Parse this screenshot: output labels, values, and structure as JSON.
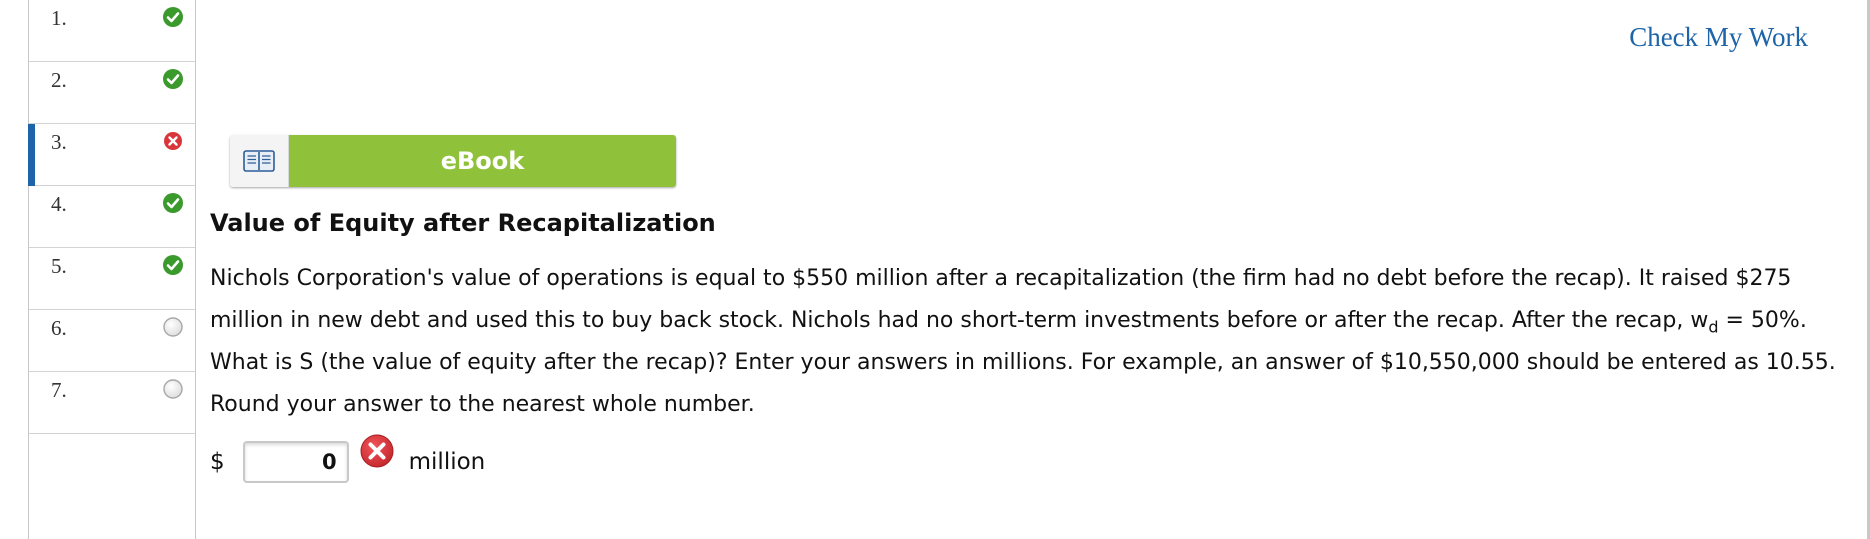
{
  "sidebar": {
    "questions": [
      {
        "number": "1.",
        "status": "correct"
      },
      {
        "number": "2.",
        "status": "correct"
      },
      {
        "number": "3.",
        "status": "incorrect"
      },
      {
        "number": "4.",
        "status": "correct"
      },
      {
        "number": "5.",
        "status": "correct"
      },
      {
        "number": "6.",
        "status": "unanswered"
      },
      {
        "number": "7.",
        "status": "unanswered"
      }
    ],
    "active_index": 2
  },
  "header": {
    "check_my_work": "Check My Work"
  },
  "ebook": {
    "label": "eBook",
    "icon": "book-icon"
  },
  "question": {
    "title": "Value of Equity after Recapitalization",
    "body_part1": "Nichols Corporation's value of operations is equal to $550 million after a recapitalization (the firm had no debt before the recap). It raised $275 million in new debt and used this to buy back stock. Nichols had no short-term investments before or after the recap. After the recap, w",
    "body_sub": "d",
    "body_part2": " = 50%. What is S (the value of equity after the recap)? Enter your answers in millions. For example, an answer of $10,550,000 should be entered as 10.55. Round your answer to the nearest whole number."
  },
  "answer": {
    "prefix": "$",
    "value": "0",
    "unit": "million",
    "status": "incorrect"
  },
  "colors": {
    "correct": "#3a9a2c",
    "incorrect": "#d8363b",
    "accent": "#1d64a8",
    "ebook_green": "#8fc23a"
  }
}
